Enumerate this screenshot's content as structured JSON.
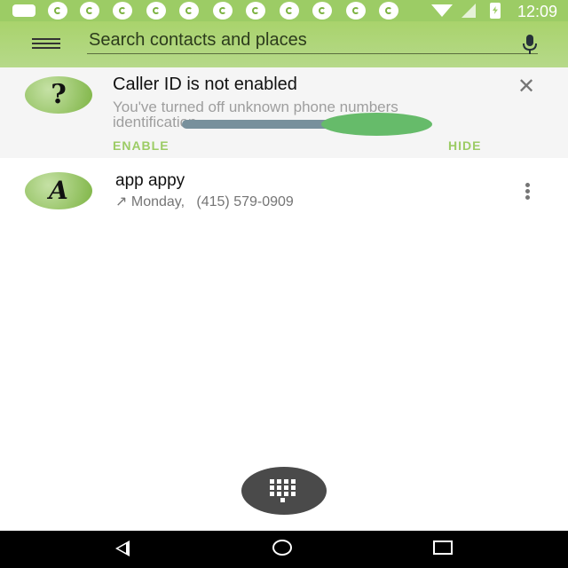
{
  "status_bar": {
    "time": "12:09",
    "notification_icons": [
      "message-icon",
      "music-note-icon",
      "music-note-icon",
      "music-note-icon",
      "music-note-icon",
      "music-note-icon",
      "music-note-icon",
      "music-note-icon",
      "music-note-icon",
      "music-note-icon",
      "music-note-icon",
      "music-note-icon"
    ],
    "system_icons": [
      "wifi-icon",
      "signal-icon",
      "battery-charging-icon"
    ]
  },
  "app_bar": {
    "search_placeholder": "Search contacts and places",
    "menu_icon": "hamburger-menu-icon",
    "mic_icon": "microphone-icon"
  },
  "caller_id_card": {
    "avatar_glyph": "?",
    "title": "Caller ID is not enabled",
    "body": "You've turned off unknown phone numbers identification",
    "enable_label": "ENABLE",
    "hide_label": "HIDE",
    "close_icon": "close-icon"
  },
  "call_log": [
    {
      "avatar_letter": "A",
      "name": "app appy",
      "call_direction_icon": "↗",
      "day": "Monday,",
      "number": "(415) 579-0909"
    }
  ],
  "fab": {
    "icon": "dialpad-icon"
  },
  "nav_bar": {
    "icons": [
      "back-icon",
      "home-icon",
      "recents-icon"
    ]
  },
  "colors": {
    "accent": "#9ccc65",
    "app_bar": "#a9d36c",
    "fab": "#4a4a4a"
  }
}
